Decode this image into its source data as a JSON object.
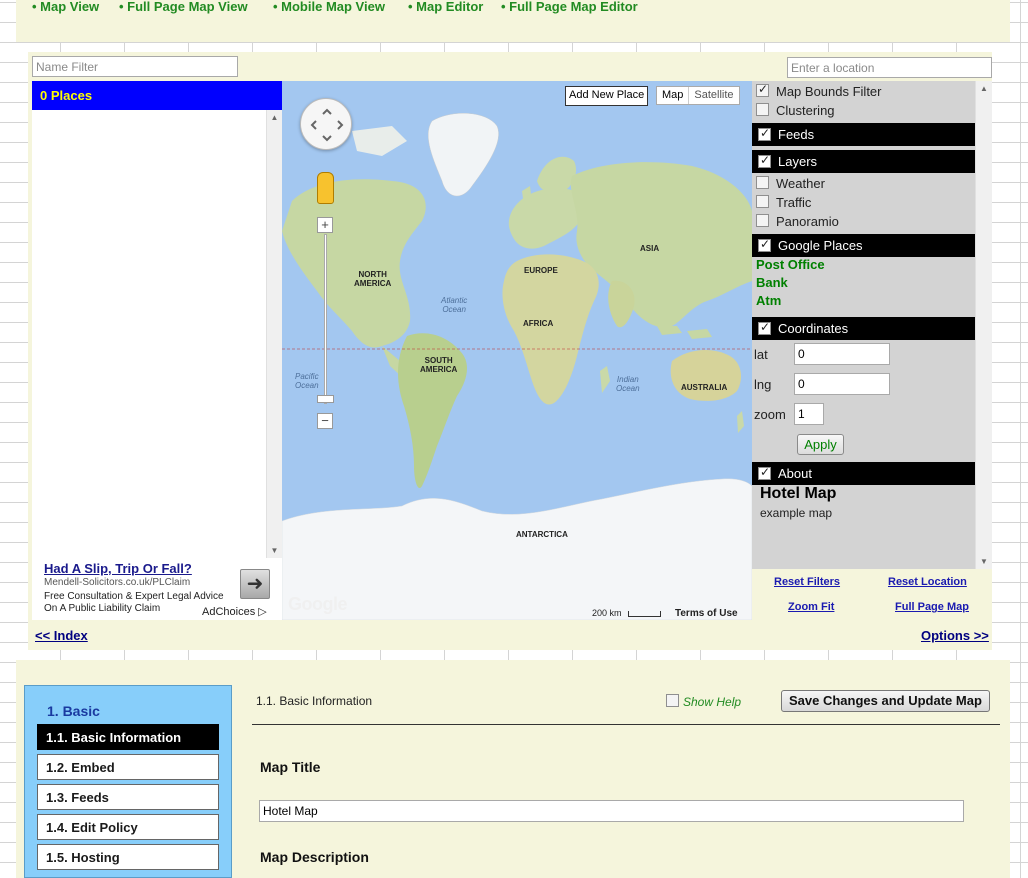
{
  "top_nav": {
    "links": [
      "• Map View",
      "• Full Page Map View",
      "• Mobile Map View",
      "• Map Editor",
      "• Full Page Map Editor"
    ]
  },
  "filters": {
    "name_filter_placeholder": "Name Filter",
    "location_placeholder": "Enter a location"
  },
  "places": {
    "header": "0 Places"
  },
  "ad": {
    "title": "Had A Slip, Trip Or Fall?",
    "url": "Mendell-Solicitors.co.uk/PLClaim",
    "desc_line1": "Free Consultation & Expert Legal Advice",
    "desc_line2": "On A Public Liability Claim",
    "choices": "AdChoices ▷"
  },
  "map": {
    "add_place_label": "Add New Place",
    "map_type_map": "Map",
    "map_type_satellite": "Satellite",
    "zoom_in": "+",
    "zoom_out": "−",
    "google_logo": "Google",
    "scale": "200 km",
    "terms": "Terms of Use",
    "labels": {
      "north_america": "NORTH\nAMERICA",
      "south_america": "SOUTH\nAMERICA",
      "europe": "EUROPE",
      "asia": "ASIA",
      "africa": "AFRICA",
      "australia": "AUSTRALIA",
      "antarctica": "ANTARCTICA",
      "atlantic": "Atlantic\nOcean",
      "pacific": "Pacific\nOcean",
      "indian": "Indian\nOcean"
    },
    "colors": {
      "water": "#a3c7f0",
      "land": "#c9d9a8",
      "ice": "#f4f6f8"
    }
  },
  "sidebar": {
    "map_bounds_filter": "Map Bounds Filter",
    "clustering": "Clustering",
    "feeds": "Feeds",
    "layers": "Layers",
    "weather": "Weather",
    "traffic": "Traffic",
    "panoramio": "Panoramio",
    "google_places": "Google Places",
    "place_types": [
      "Post Office",
      "Bank",
      "Atm"
    ],
    "coordinates": "Coordinates",
    "lat_label": "lat",
    "lat_value": "0",
    "lng_label": "lng",
    "lng_value": "0",
    "zoom_label": "zoom",
    "zoom_value": "1",
    "apply": "Apply",
    "about": "About",
    "about_title": "Hotel Map",
    "about_desc": "example map"
  },
  "map_links": {
    "reset_filters": "Reset Filters",
    "reset_location": "Reset Location",
    "zoom_fit": "Zoom Fit",
    "full_page_map": "Full Page Map"
  },
  "footer_links": {
    "index": "<< Index",
    "options": "Options >>"
  },
  "settings": {
    "group_title": "1. Basic",
    "nav_items": [
      "1.1. Basic Information",
      "1.2. Embed",
      "1.3. Feeds",
      "1.4. Edit Policy",
      "1.5. Hosting"
    ],
    "section_title": "1.1. Basic Information",
    "show_help": "Show Help",
    "save_button": "Save Changes and Update Map",
    "map_title_label": "Map Title",
    "map_title_value": "Hotel Map",
    "map_description_label": "Map Description"
  }
}
